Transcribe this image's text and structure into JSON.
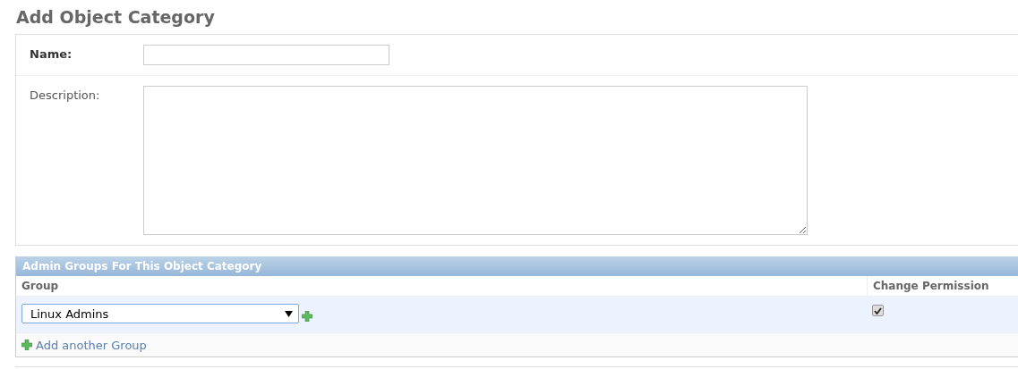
{
  "title": "Add Object Category",
  "fields": [
    {
      "kind": "input",
      "label": "Name:",
      "required": true
    },
    {
      "kind": "textarea",
      "label": "Description:",
      "required": false
    }
  ],
  "inline": {
    "title": "Admin Groups For This Object Category",
    "columns": [
      "Group",
      "Change Permission"
    ],
    "rows": [
      {
        "group": "Linux Admins",
        "change_permission": true
      }
    ],
    "add_link": "Add another Group"
  }
}
